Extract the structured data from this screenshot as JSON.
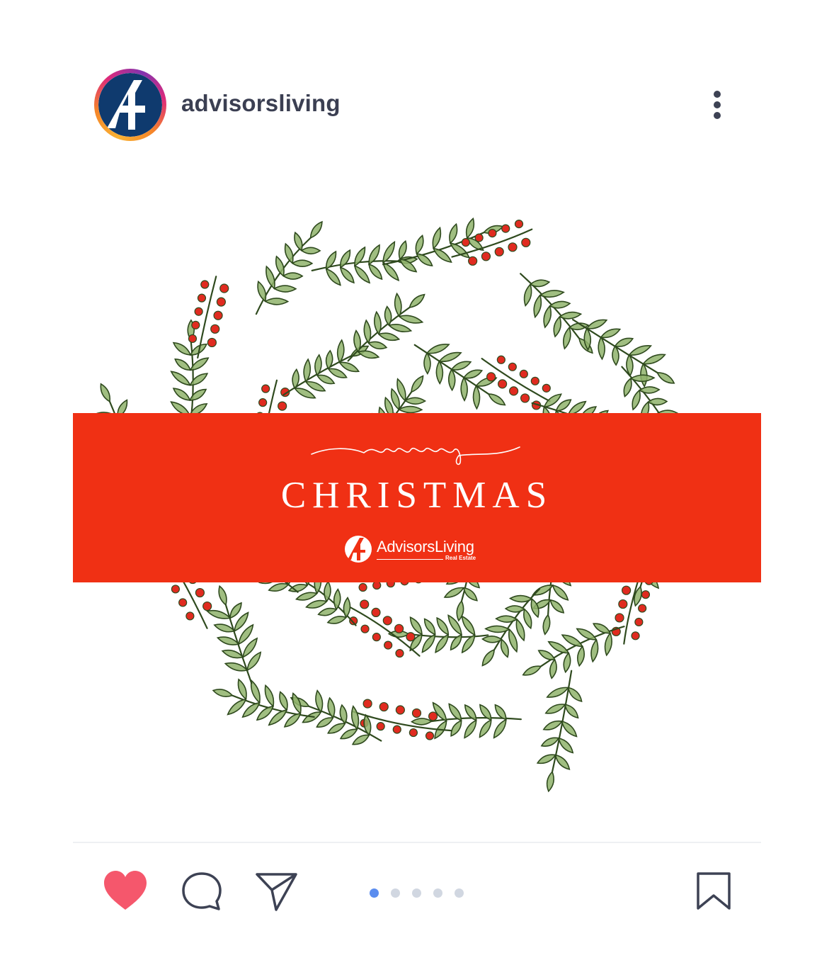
{
  "post": {
    "username": "advisorsliving",
    "avatar_icon": "advisorsliving-logo-icon",
    "menu_icon": "more-vertical-icon",
    "colors": {
      "banner": "#f03014",
      "leaf_fill": "#8fb36b",
      "leaf_stroke": "#2f4a1e",
      "berry": "#e02b20",
      "logo_blue": "#0f3a6e",
      "like": "#f5576c",
      "pager_active": "#5b8def",
      "pager_inactive": "#d1d7e1"
    }
  },
  "banner": {
    "script_text": "merry",
    "headline": "CHRISTMAS",
    "brand_name": "AdvisorsLiving",
    "brand_sub": "Real Estate"
  },
  "actions": {
    "like_icon": "heart-icon",
    "comment_icon": "comment-icon",
    "share_icon": "send-icon",
    "save_icon": "bookmark-icon"
  },
  "pager": {
    "total": 5,
    "active": 1
  }
}
